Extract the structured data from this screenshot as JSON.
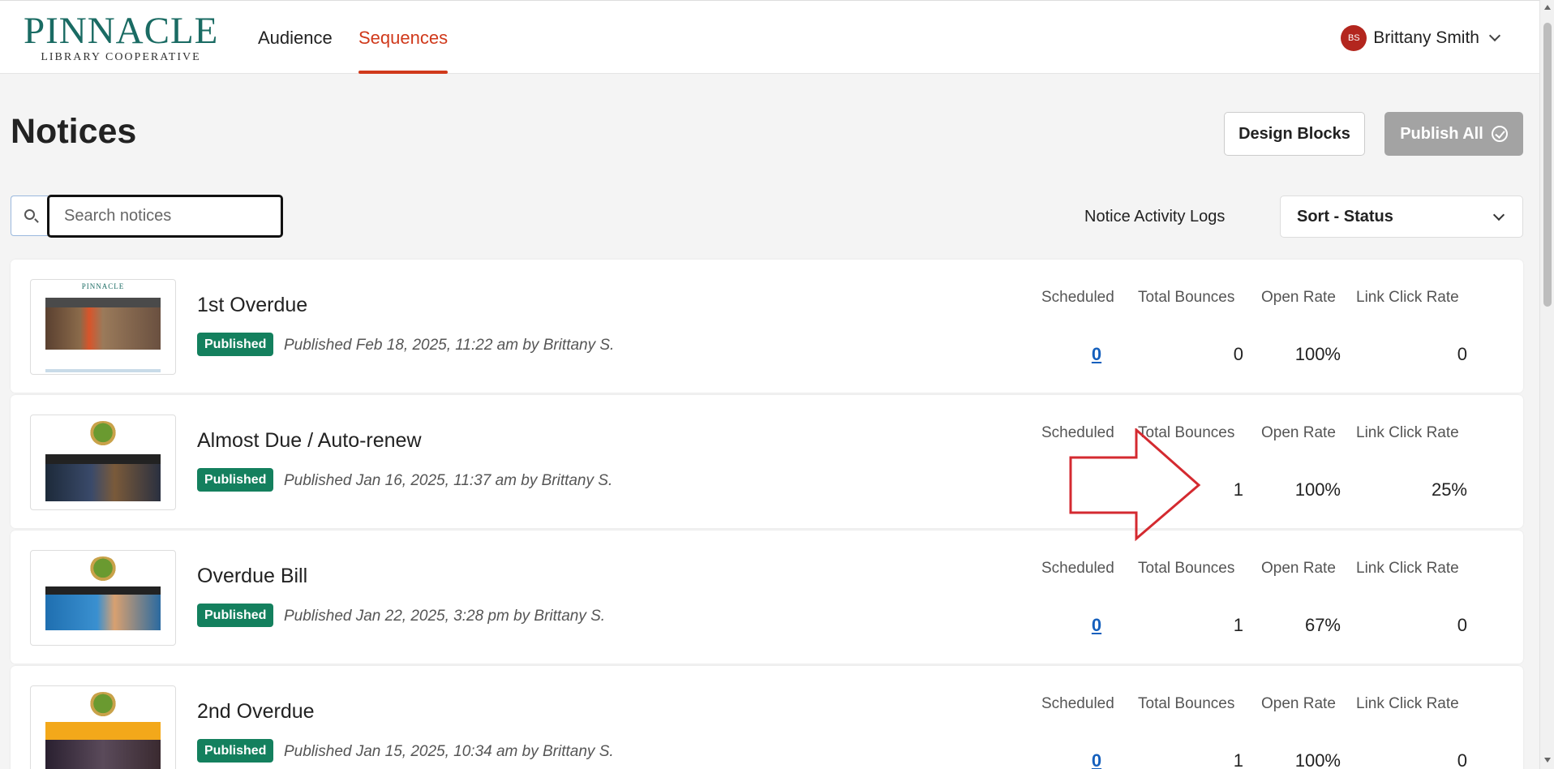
{
  "header": {
    "logo_main": "PINNACLE",
    "logo_sub": "LIBRARY COOPERATIVE",
    "nav": [
      "Audience",
      "Sequences"
    ],
    "user_initials": "BS",
    "user_name": "Brittany Smith"
  },
  "page": {
    "title": "Notices",
    "design_blocks_label": "Design Blocks",
    "publish_all_label": "Publish All",
    "search_placeholder": "Search notices",
    "search_value": "",
    "activity_logs_label": "Notice Activity Logs",
    "sort_label": "Sort - Status"
  },
  "stat_headers": {
    "scheduled": "Scheduled",
    "bounces": "Total Bounces",
    "open_rate": "Open Rate",
    "click_rate": "Link Click Rate"
  },
  "notices": [
    {
      "name": "1st Overdue",
      "status": "Published",
      "published": "Published Feb 18, 2025, 11:22 am by Brittany  S.",
      "scheduled": "0",
      "bounces": "0",
      "open_rate": "100%",
      "click_rate": "0"
    },
    {
      "name": "Almost Due / Auto-renew",
      "status": "Published",
      "published": "Published Jan 16, 2025, 11:37 am by Brittany  S.",
      "scheduled": "",
      "bounces": "1",
      "open_rate": "100%",
      "click_rate": "25%"
    },
    {
      "name": "Overdue Bill",
      "status": "Published",
      "published": "Published Jan 22, 2025, 3:28 pm by Brittany  S.",
      "scheduled": "0",
      "bounces": "1",
      "open_rate": "67%",
      "click_rate": "0"
    },
    {
      "name": "2nd Overdue",
      "status": "Published",
      "published": "Published Jan 15, 2025, 10:34 am by Brittany  S.",
      "scheduled": "0",
      "bounces": "1",
      "open_rate": "100%",
      "click_rate": "0"
    }
  ],
  "colors": {
    "accent": "#d0391b",
    "brand": "#1a6b63",
    "badge": "#14805e",
    "link": "#1560bd",
    "annotation_arrow": "#d42a30"
  }
}
